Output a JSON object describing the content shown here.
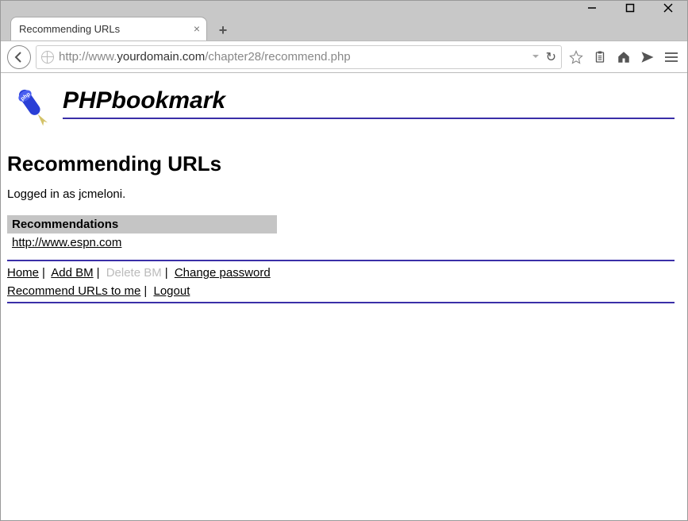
{
  "window": {
    "tab_title": "Recommending URLs",
    "url_prefix": "http://www.",
    "url_bold": "yourdomain.com",
    "url_suffix": "/chapter28/recommend.php"
  },
  "page": {
    "brand": "PHPbookmark",
    "title": "Recommending URLs",
    "login_status": "Logged in as jcmeloni.",
    "recommendations_header": "Recommendations",
    "recommendations": [
      {
        "url": "http://www.espn.com"
      }
    ],
    "footer": {
      "home": "Home",
      "add_bm": "Add BM",
      "delete_bm": "Delete BM",
      "change_password": "Change password",
      "recommend": "Recommend URLs to me",
      "logout": "Logout"
    }
  }
}
